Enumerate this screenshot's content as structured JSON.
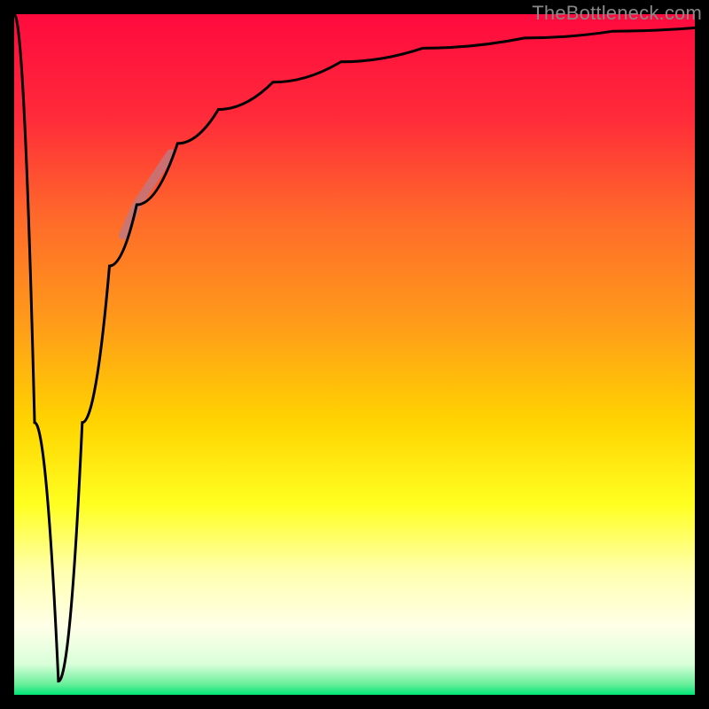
{
  "watermark": "TheBottleneck.com",
  "colors": {
    "frame": "#000000",
    "curve": "#000000",
    "highlight_segment": "#c07780",
    "gradient_stops": [
      {
        "offset": 0.0,
        "color": "#ff0a3e"
      },
      {
        "offset": 0.15,
        "color": "#ff2a3a"
      },
      {
        "offset": 0.3,
        "color": "#ff6a2a"
      },
      {
        "offset": 0.45,
        "color": "#ff9a1a"
      },
      {
        "offset": 0.6,
        "color": "#ffd400"
      },
      {
        "offset": 0.72,
        "color": "#ffff20"
      },
      {
        "offset": 0.82,
        "color": "#ffffb0"
      },
      {
        "offset": 0.9,
        "color": "#ffffe8"
      },
      {
        "offset": 0.955,
        "color": "#d9ffd9"
      },
      {
        "offset": 0.985,
        "color": "#66ee99"
      },
      {
        "offset": 1.0,
        "color": "#00e676"
      }
    ]
  },
  "chart_data": {
    "type": "line",
    "x": [
      0,
      0.03,
      0.065,
      0.1,
      0.14,
      0.18,
      0.24,
      0.3,
      0.38,
      0.48,
      0.6,
      0.75,
      0.88,
      1.0
    ],
    "y": [
      1.0,
      0.4,
      0.02,
      0.4,
      0.63,
      0.72,
      0.81,
      0.86,
      0.9,
      0.93,
      0.95,
      0.965,
      0.975,
      0.98
    ],
    "xlim": [
      0,
      1
    ],
    "ylim": [
      0,
      1
    ],
    "highlight_range_x": [
      0.16,
      0.23
    ],
    "title": "",
    "xlabel": "",
    "ylabel": ""
  }
}
